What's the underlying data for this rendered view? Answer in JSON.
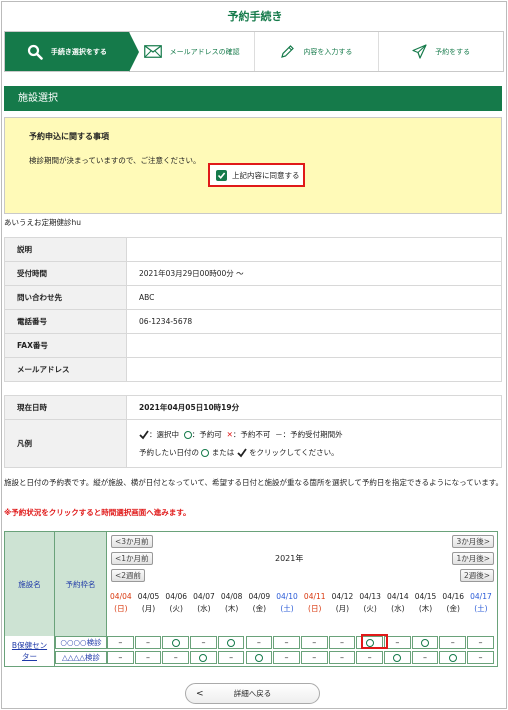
{
  "page_title": "予約手続き",
  "steps": [
    {
      "label": "手続き選択をする",
      "icon": "search-icon"
    },
    {
      "label": "メールアドレスの確認",
      "icon": "envelope-icon"
    },
    {
      "label": "内容を入力する",
      "icon": "pencil-icon"
    },
    {
      "label": "予約をする",
      "icon": "paper-plane-icon"
    }
  ],
  "section_title": "施設選択",
  "notice": {
    "title": "予約申込に関する事項",
    "text": "検診期間が決まっていますので、ご注意ください。",
    "agree_label": "上記内容に同意する"
  },
  "facility_name": "あいうえお定期健診hu",
  "info": [
    {
      "label": "説明",
      "value": ""
    },
    {
      "label": "受付時間",
      "value": "2021年03月29日00時00分 ～"
    },
    {
      "label": "問い合わせ先",
      "value": "ABC"
    },
    {
      "label": "電話番号",
      "value": "06-1234-5678"
    },
    {
      "label": "FAX番号",
      "value": ""
    },
    {
      "label": "メールアドレス",
      "value": ""
    }
  ],
  "current": {
    "label": "現在日時",
    "value": "2021年04月05日10時19分"
  },
  "legend": {
    "label": "凡例",
    "selecting": "：選択中",
    "available": "：予約可",
    "unavailable": "：予約不可",
    "out_of_period_mark": "－",
    "out_of_period": "：予約受付期間外",
    "instruction_pre": "予約したい日付の",
    "instruction_or": "または",
    "instruction_post": "をクリックしてください。"
  },
  "description": "施設と日付の予約表です。縦が施設、横が日付となっていて、希望する日付と施設が重なる箇所を選択して予約日を指定できるようになっています。",
  "warning": "※予約状況をクリックすると時間選択画面へ進みます。",
  "calendar": {
    "col_facility": "施設名",
    "col_reservation": "予約枠名",
    "prev_3m": "<3か月前",
    "prev_1m": "<1か月前",
    "prev_2w": "<2週前",
    "next_3m": "3か月後>",
    "next_1m": "1か月後>",
    "next_2w": "2週後>",
    "year": "2021年",
    "dates": [
      {
        "d": "04/04",
        "w": "(日)",
        "color": "#d9380e"
      },
      {
        "d": "04/05",
        "w": "(月)",
        "color": "#222222"
      },
      {
        "d": "04/06",
        "w": "(火)",
        "color": "#222222"
      },
      {
        "d": "04/07",
        "w": "(水)",
        "color": "#222222"
      },
      {
        "d": "04/08",
        "w": "(木)",
        "color": "#222222"
      },
      {
        "d": "04/09",
        "w": "(金)",
        "color": "#222222"
      },
      {
        "d": "04/10",
        "w": "(土)",
        "color": "#2a5bd7"
      },
      {
        "d": "04/11",
        "w": "(日)",
        "color": "#d9380e"
      },
      {
        "d": "04/12",
        "w": "(月)",
        "color": "#222222"
      },
      {
        "d": "04/13",
        "w": "(火)",
        "color": "#222222"
      },
      {
        "d": "04/14",
        "w": "(水)",
        "color": "#222222"
      },
      {
        "d": "04/15",
        "w": "(木)",
        "color": "#222222"
      },
      {
        "d": "04/16",
        "w": "(金)",
        "color": "#222222"
      },
      {
        "d": "04/17",
        "w": "(土)",
        "color": "#2a5bd7"
      }
    ],
    "facility": "B保健センター",
    "facility_line1": "B保健セン",
    "facility_line2": "ター",
    "rows": [
      {
        "name": "○○○○検診",
        "cells": [
          "-",
          "-",
          "o",
          "-",
          "o",
          "-",
          "-",
          "-",
          "-",
          "o",
          "-",
          "o",
          "-",
          "-"
        ]
      },
      {
        "name": "△△△△検診",
        "cells": [
          "-",
          "-",
          "-",
          "o",
          "-",
          "o",
          "-",
          "-",
          "-",
          "-",
          "o",
          "-",
          "o",
          "-"
        ]
      }
    ]
  },
  "back_label": "詳細へ戻る",
  "colors": {
    "brand": "#157a4a",
    "notice_bg": "#fffab8",
    "highlight": "#e01919"
  }
}
